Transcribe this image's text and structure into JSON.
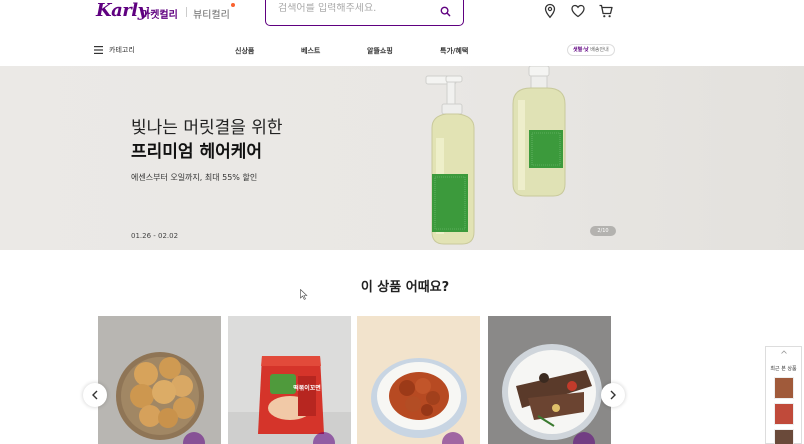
{
  "header": {
    "logo": "Karly",
    "brand_tabs": [
      "마켓컬리",
      "뷰티컬리"
    ],
    "search_placeholder": "검색어를 입력해주세요.",
    "icons": [
      "location-icon",
      "heart-icon",
      "cart-icon"
    ]
  },
  "nav": {
    "category_label": "카테고리",
    "items": [
      "신상품",
      "베스트",
      "알뜰쇼핑",
      "특가/혜택"
    ],
    "delivery_badge_strong": "샛별·낮",
    "delivery_badge_rest": " 배송안내"
  },
  "banner": {
    "title_line1": "빛나는 머릿결을 위한",
    "title_line2": "프리미엄 헤어케어",
    "subtitle": "에센스부터 오일까지, 최대 55% 할인",
    "dates": "01.26 - 02.02",
    "counter": "2/10"
  },
  "recommend": {
    "title": "이 상품 어때요?",
    "products": [
      {
        "name": "product-1",
        "image": "fried-dumplings"
      },
      {
        "name": "product-2",
        "image": "spicy-noodle-pack"
      },
      {
        "name": "product-3",
        "image": "braised-chicken"
      },
      {
        "name": "product-4",
        "image": "galbi-jjim"
      }
    ],
    "pack_text": "떡볶이꼬면"
  },
  "recent": {
    "label": "최근 본 상품"
  },
  "colors": {
    "brand": "#5f0080",
    "accent": "#fa622f"
  }
}
